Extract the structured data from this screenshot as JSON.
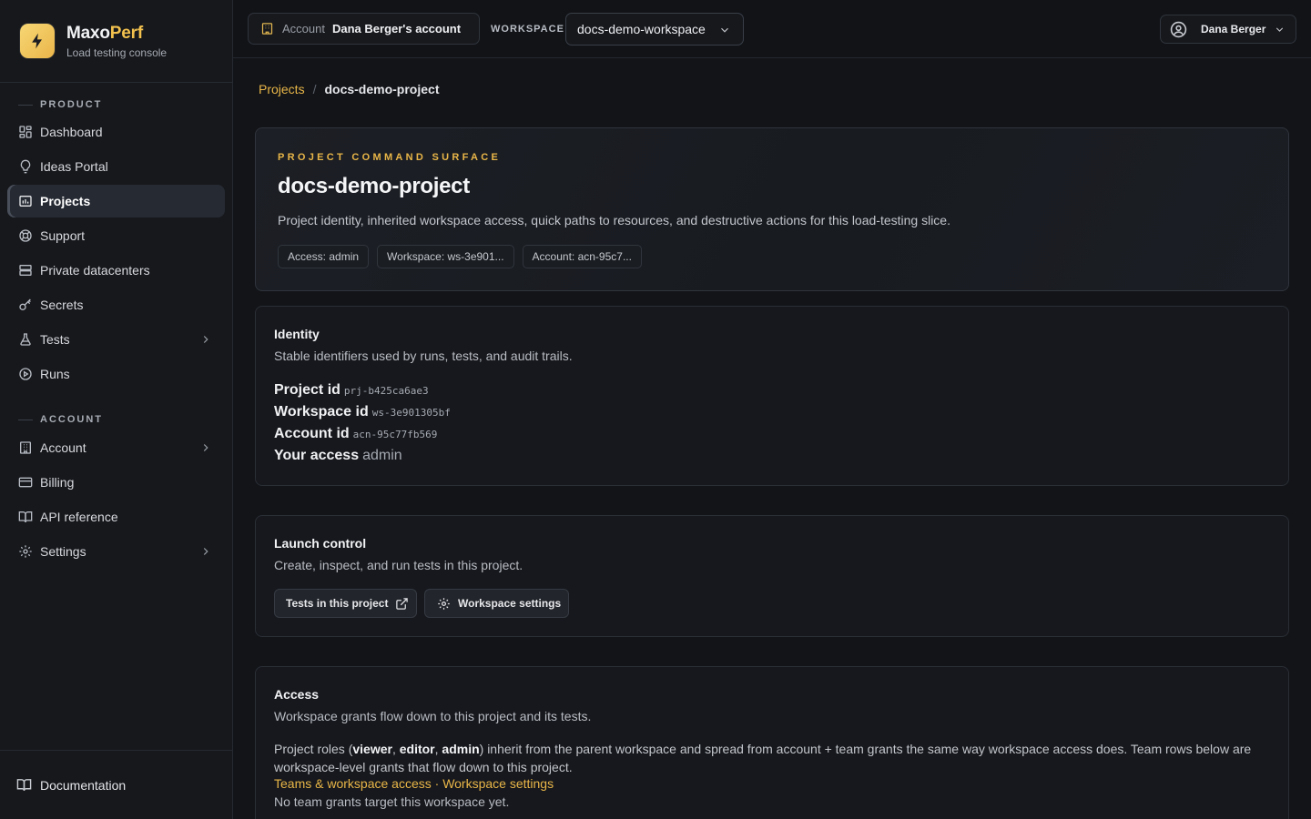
{
  "brand": {
    "name_part1": "Maxo",
    "name_part2": "Perf",
    "subtitle": "Load testing console",
    "accent": "#f2c14e"
  },
  "sidebar": {
    "sections": {
      "product": "PRODUCT",
      "account": "ACCOUNT"
    },
    "product_items": [
      {
        "label": "Dashboard",
        "icon": "dashboard-icon"
      },
      {
        "label": "Ideas Portal",
        "icon": "lightbulb-icon"
      },
      {
        "label": "Projects",
        "icon": "projects-icon",
        "active": true
      },
      {
        "label": "Support",
        "icon": "lifebuoy-icon"
      },
      {
        "label": "Private datacenters",
        "icon": "server-icon"
      },
      {
        "label": "Secrets",
        "icon": "key-icon"
      },
      {
        "label": "Tests",
        "icon": "flask-icon",
        "expandable": true
      },
      {
        "label": "Runs",
        "icon": "play-circle-icon"
      }
    ],
    "account_items": [
      {
        "label": "Account",
        "icon": "building-icon",
        "expandable": true
      },
      {
        "label": "Billing",
        "icon": "credit-card-icon"
      },
      {
        "label": "API reference",
        "icon": "book-icon"
      },
      {
        "label": "Settings",
        "icon": "gear-icon",
        "expandable": true
      }
    ],
    "footer": {
      "label": "Documentation",
      "icon": "book-open-icon"
    }
  },
  "topbar": {
    "account_label": "Account",
    "account_value": "Dana Berger's account",
    "workspace_label": "WORKSPACE",
    "workspace_value": "docs-demo-workspace",
    "user_name": "Dana Berger"
  },
  "breadcrumb": {
    "parent": "Projects",
    "separator": "/",
    "current": "docs-demo-project"
  },
  "hero": {
    "eyebrow": "PROJECT COMMAND SURFACE",
    "title": "docs-demo-project",
    "description": "Project identity, inherited workspace access, quick paths to resources, and destructive actions for this load-testing slice.",
    "chips": [
      "Access: admin",
      "Workspace: ws-3e901...",
      "Account: acn-95c7..."
    ]
  },
  "identity": {
    "title": "Identity",
    "description": "Stable identifiers used by runs, tests, and audit trails.",
    "rows": [
      {
        "label": "Project id",
        "value": "prj-b425ca6ae3"
      },
      {
        "label": "Workspace id",
        "value": "ws-3e901305bf"
      },
      {
        "label": "Account id",
        "value": "acn-95c77fb569"
      },
      {
        "label": "Your access",
        "value": "admin"
      }
    ]
  },
  "launch": {
    "title": "Launch control",
    "description": "Create, inspect, and run tests in this project.",
    "tests_button": "Tests in this project",
    "settings_button": "Workspace settings"
  },
  "access": {
    "title": "Access",
    "description": "Workspace grants flow down to this project and its tests.",
    "roles_prefix": "Project roles (",
    "role_viewer": "viewer",
    "comma1": ", ",
    "role_editor": "editor",
    "comma2": ", ",
    "role_admin": "admin",
    "roles_suffix": ") inherit from the parent workspace and spread from account + team grants the same way workspace access does. Team rows below are workspace-level grants that flow down to this project.",
    "link_teams": "Teams & workspace access",
    "link_sep": " · ",
    "link_settings": "Workspace settings",
    "empty": "No team grants target this workspace yet."
  }
}
